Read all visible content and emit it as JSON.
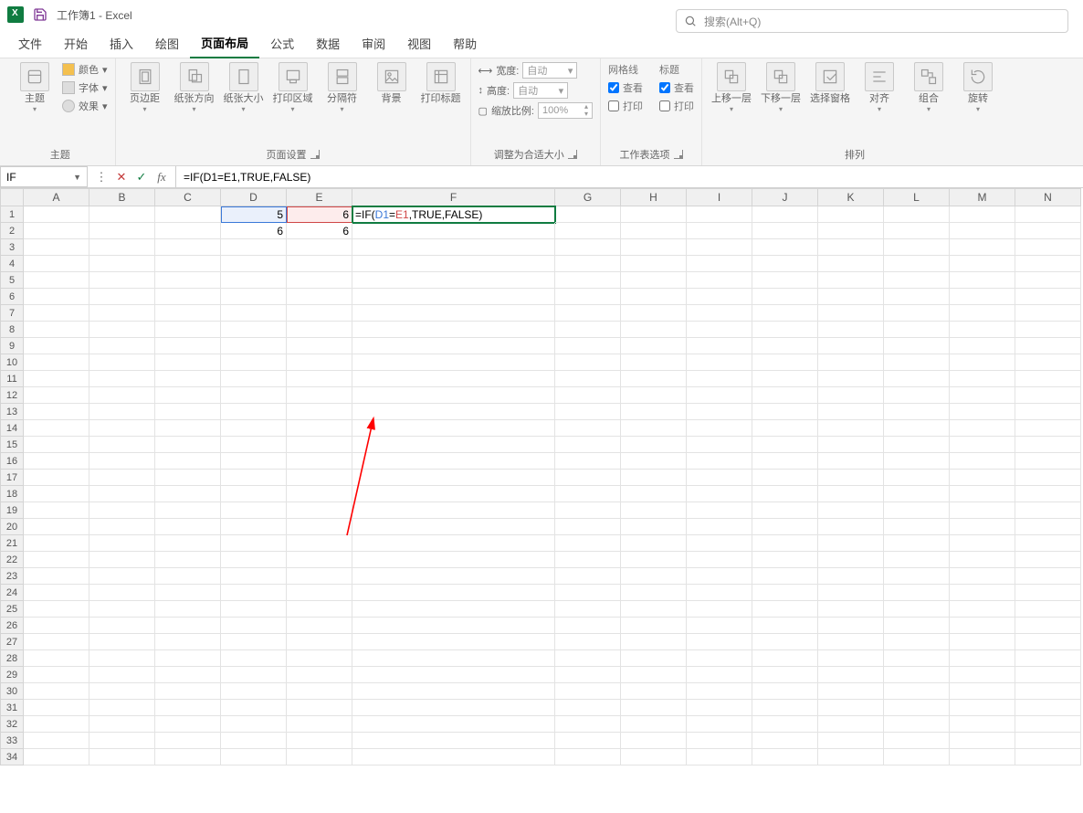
{
  "title": {
    "workbook": "工作簿1",
    "sep": " - ",
    "app": "Excel"
  },
  "search": {
    "placeholder": "搜索(Alt+Q)"
  },
  "tabs": [
    "文件",
    "开始",
    "插入",
    "绘图",
    "页面布局",
    "公式",
    "数据",
    "审阅",
    "视图",
    "帮助"
  ],
  "active_tab": "页面布局",
  "ribbon": {
    "theme": {
      "label": "主题",
      "btn": "主题",
      "color": "颜色",
      "font": "字体",
      "effect": "效果"
    },
    "page": {
      "label": "页面设置",
      "margins": "页边距",
      "orient": "纸张方向",
      "size": "纸张大小",
      "area": "打印区域",
      "breaks": "分隔符",
      "bg": "背景",
      "titles": "打印标题"
    },
    "scale": {
      "label": "调整为合适大小",
      "width": "宽度:",
      "height": "高度:",
      "ratio": "缩放比例:",
      "auto": "自动",
      "pct": "100%"
    },
    "sheetopt": {
      "label": "工作表选项",
      "grid": "网格线",
      "head": "标题",
      "view": "查看",
      "print": "打印"
    },
    "arrange": {
      "label": "排列",
      "fwd": "上移一层",
      "back": "下移一层",
      "pane": "选择窗格",
      "align": "对齐",
      "group": "组合",
      "rotate": "旋转"
    }
  },
  "formula_bar": {
    "name": "IF",
    "text": "=IF(D1=E1,TRUE,FALSE)"
  },
  "columns": [
    "A",
    "B",
    "C",
    "D",
    "E",
    "F",
    "G",
    "H",
    "I",
    "J",
    "K",
    "L",
    "M",
    "N"
  ],
  "rows": 34,
  "cells": {
    "D1": "5",
    "E1": "6",
    "D2": "6",
    "E2": "6"
  },
  "edit_cell": {
    "address": "F1",
    "pre": "=IF(",
    "d": "D1",
    "eq": "=",
    "e": "E1",
    "post": ",TRUE,FALSE)"
  }
}
